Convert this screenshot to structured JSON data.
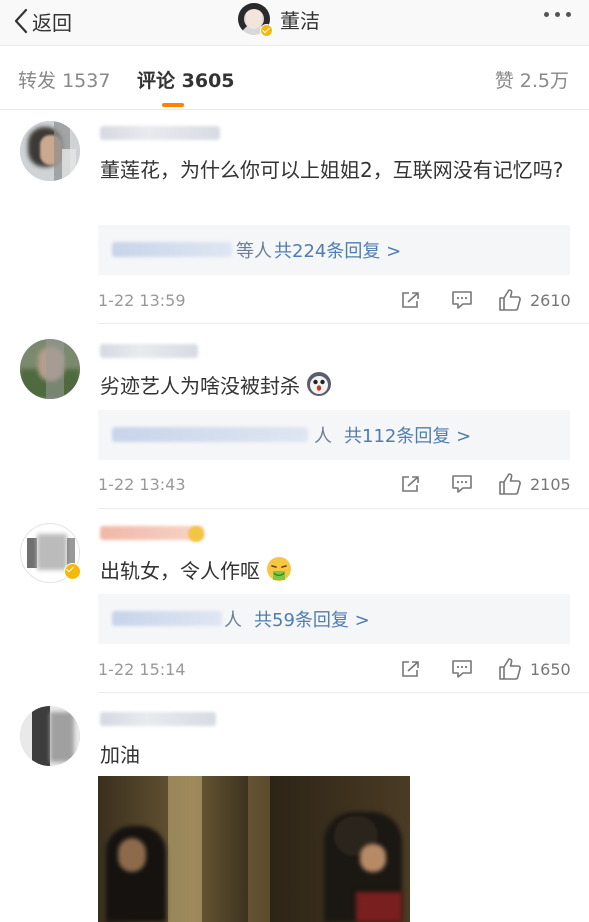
{
  "navbar": {
    "back_label": "返回",
    "title": "董洁"
  },
  "tabs": {
    "repost": {
      "label": "转发",
      "count": "1537"
    },
    "comment": {
      "label": "评论",
      "count": "3605"
    },
    "like": {
      "label": "赞",
      "count": "2.5万"
    }
  },
  "comments": [
    {
      "text": "董莲花，为什么你可以上姐姐2，互联网没有记忆吗?",
      "reply_suffix": "等人",
      "reply_total": "共224条回复 >",
      "time": "1-22 13:59",
      "likes": "2610",
      "emoji": ""
    },
    {
      "text": "劣迹艺人为啥没被封杀",
      "reply_suffix": "人",
      "reply_total": "共112条回复 >",
      "time": "1-22 13:43",
      "likes": "2105",
      "emoji": "scared-face"
    },
    {
      "text": "出轨女，令人作呕",
      "reply_suffix": "人",
      "reply_total": "共59条回复 >",
      "time": "1-22 15:14",
      "likes": "1650",
      "emoji": "vomiting-face"
    },
    {
      "text": "加油"
    }
  ],
  "colors": {
    "accent": "#ff8200",
    "link": "#507daf",
    "verified": "#f6b80a"
  }
}
